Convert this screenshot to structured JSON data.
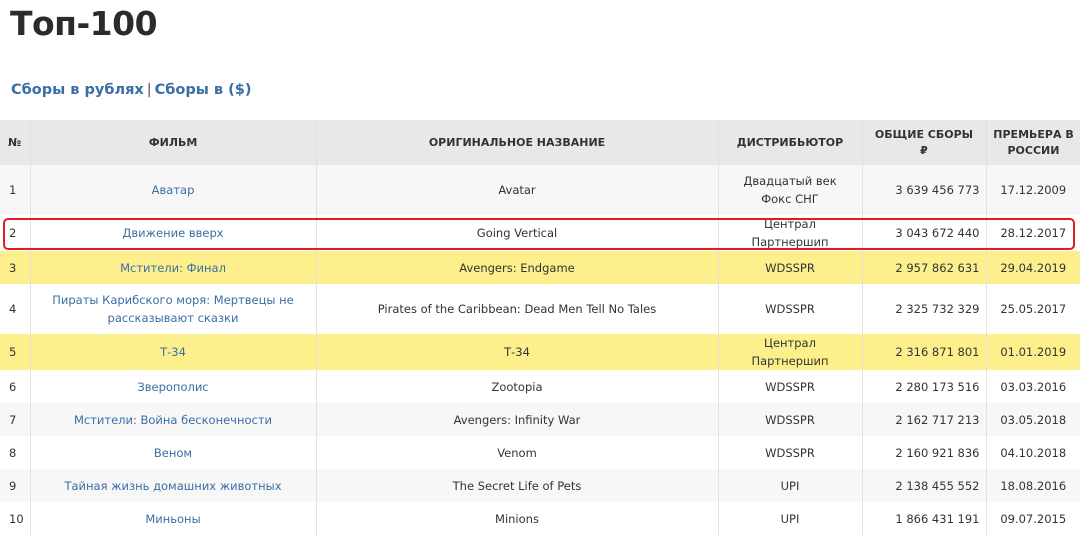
{
  "page": {
    "title": "Топ-100"
  },
  "links": {
    "rub": "Сборы в рублях",
    "sep": "|",
    "usd": "Сборы в ($)"
  },
  "table": {
    "headers": {
      "num": "№",
      "film": "ФИЛЬМ",
      "original": "ОРИГИНАЛЬНОЕ НАЗВАНИЕ",
      "distributor": "ДИСТРИБЬЮТОР",
      "gross": "ОБЩИЕ СБОРЫ ₽",
      "premiere": "ПРЕМЬЕРА В РОССИИ"
    },
    "rows": [
      {
        "num": "1",
        "film": "Аватар",
        "original": "Avatar",
        "distributor": "Двадцатый век Фокс СНГ",
        "gross": "3 639 456 773",
        "premiere": "17.12.2009",
        "highlight": false
      },
      {
        "num": "2",
        "film": "Движение вверх",
        "original": "Going Vertical",
        "distributor": "Централ Партнершип",
        "gross": "3 043 672 440",
        "premiere": "28.12.2017",
        "highlight": false
      },
      {
        "num": "3",
        "film": "Мстители: Финал",
        "original": "Avengers: Endgame",
        "distributor": "WDSSPR",
        "gross": "2 957 862 631",
        "premiere": "29.04.2019",
        "highlight": true
      },
      {
        "num": "4",
        "film": "Пираты Карибского моря: Мертвецы не рассказывают сказки",
        "original": "Pirates of the Caribbean: Dead Men Tell No Tales",
        "distributor": "WDSSPR",
        "gross": "2 325 732 329",
        "premiere": "25.05.2017",
        "highlight": false
      },
      {
        "num": "5",
        "film": "Т-34",
        "original": "Т-34",
        "distributor": "Централ Партнершип",
        "gross": "2 316 871 801",
        "premiere": "01.01.2019",
        "highlight": true
      },
      {
        "num": "6",
        "film": "Зверополис",
        "original": "Zootopia",
        "distributor": "WDSSPR",
        "gross": "2 280 173 516",
        "premiere": "03.03.2016",
        "highlight": false
      },
      {
        "num": "7",
        "film": "Мстители: Война бесконечности",
        "original": "Avengers: Infinity War",
        "distributor": "WDSSPR",
        "gross": "2 162 717 213",
        "premiere": "03.05.2018",
        "highlight": false
      },
      {
        "num": "8",
        "film": "Веном",
        "original": "Venom",
        "distributor": "WDSSPR",
        "gross": "2 160 921 836",
        "premiere": "04.10.2018",
        "highlight": false
      },
      {
        "num": "9",
        "film": "Тайная жизнь домашних животных",
        "original": "The Secret Life of Pets",
        "distributor": "UPI",
        "gross": "2 138 455 552",
        "premiere": "18.08.2016",
        "highlight": false
      },
      {
        "num": "10",
        "film": "Миньоны",
        "original": "Minions",
        "distributor": "UPI",
        "gross": "1 866 431 191",
        "premiere": "09.07.2015",
        "highlight": false
      }
    ]
  },
  "colors": {
    "link": "#3a6ea5",
    "highlight": "#fdf08c",
    "annotation": "#e01b24"
  }
}
